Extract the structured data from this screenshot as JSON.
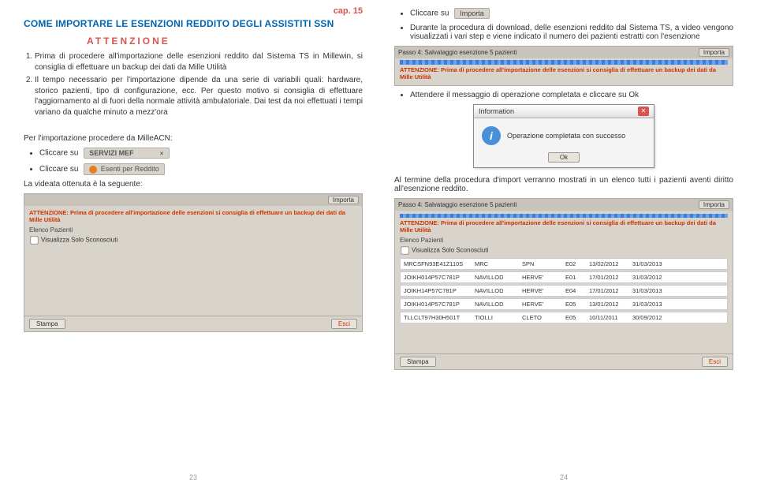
{
  "cap": "cap. 15",
  "title": "COME IMPORTARE LE ESENZIONI REDDITO DEGLI ASSISTITI SSN",
  "attenzione": "ATTENZIONE",
  "ol": [
    "Prima di procedere all'importazione delle esenzioni reddito dal Sistema TS in Millewin, si consiglia di effettuare un backup dei dati da Mille Utilità",
    "Il tempo necessario per l'importazione dipende da una serie di variabili quali: hardware, storico pazienti, tipo di configurazione, ecc. Per questo motivo si consiglia di effettuare l'aggiornamento al di fuori della normale attività ambulatoriale. Dai test da noi effettuati i tempi variano da qualche minuto a mezz'ora"
  ],
  "per_imp": "Per l'importazione procedere da MilleACN:",
  "cliccare": "Cliccare su",
  "servizi_mef": "SERVIZI MEF",
  "esenti_reddito": "Esenti per Reddito",
  "videata": "La videata ottenuta è la seguente:",
  "importa_btn": "Importa",
  "durante": "Durante la procedura di download, delle esenzioni reddito dal Sistema TS, a video vengono visualizzati i vari step e viene indicato il numero dei pazienti estratti con l'esenzione",
  "attendere": "Attendere il messaggio di operazione completata e cliccare su Ok",
  "al_termine": "Al termine della procedura d'import verranno mostrati in un elenco tutti i pazienti aventi diritto all'esenzione reddito.",
  "ss1": {
    "header": "Passo 4: Salvataggio esenzione 5 pazienti",
    "warn": "ATTENZIONE: Prima di procedere all'importazione delle esenzioni si consiglia di effettuare un backup dei dati da Mille Utilità",
    "section": "Elenco Pazienti",
    "check": "Visualizza Solo Sconosciuti",
    "stampa": "Stampa",
    "esci": "Esci",
    "importa": "Importa"
  },
  "dialog": {
    "title": "Information",
    "msg": "Operazione completata con successo",
    "ok": "Ok"
  },
  "rows": [
    {
      "cf": "MRCSFN93E41Z110S",
      "cog": "MRC",
      "nom": "SPN",
      "cod": "E02",
      "d1": "13/02/2012",
      "d2": "31/03/2013"
    },
    {
      "cf": "JOIKH014P57C781P",
      "cog": "NAVILLOD",
      "nom": "HERVE'",
      "cod": "E01",
      "d1": "17/01/2012",
      "d2": "31/03/2012"
    },
    {
      "cf": "JOIKH14P57C781P",
      "cog": "NAVILLOD",
      "nom": "HERVE'",
      "cod": "E04",
      "d1": "17/01/2012",
      "d2": "31/03/2013"
    },
    {
      "cf": "JOIKH014P57C781P",
      "cog": "NAVILLOD",
      "nom": "HERVE'",
      "cod": "E05",
      "d1": "13/01/2012",
      "d2": "31/03/2013"
    },
    {
      "cf": "TLLCLT97H30H501T",
      "cog": "TIOLLI",
      "nom": "CLETO",
      "cod": "E05",
      "d1": "10/11/2011",
      "d2": "30/09/2012"
    }
  ],
  "page_left": "23",
  "page_right": "24"
}
